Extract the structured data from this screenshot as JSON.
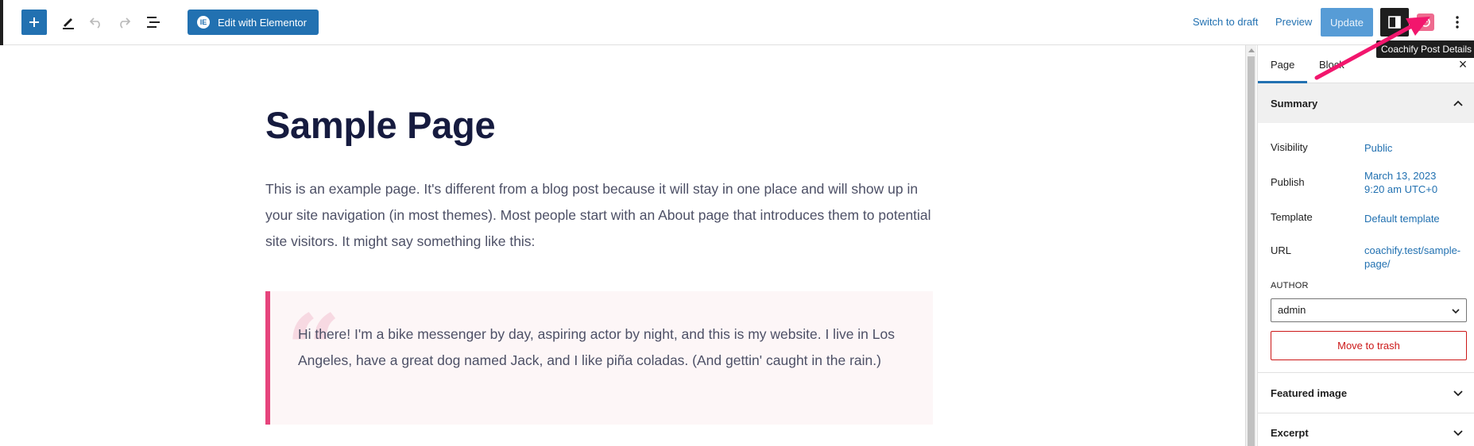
{
  "toolbar": {
    "edit_elementor_label": "Edit with Elementor",
    "elementor_badge": "IE",
    "switch_to_draft_label": "Switch to draft",
    "preview_label": "Preview",
    "update_label": "Update",
    "tooltip": "Coachify Post Details",
    "accent_color": "#2271b1"
  },
  "content": {
    "title": "Sample Page",
    "intro": "This is an example page. It's different from a blog post because it will stay in one place and will show up in your site navigation (in most themes). Most people start with an About page that introduces them to potential site visitors. It might say something like this:",
    "quote": "Hi there! I'm a bike messenger by day, aspiring actor by night, and this is my website. I live in Los Angeles, have a great dog named Jack, and I like piña coladas. (And gettin' caught in the rain.)",
    "quote_mark": "“"
  },
  "sidebar": {
    "tabs": [
      {
        "label": "Page",
        "active": true
      },
      {
        "label": "Block",
        "active": false
      }
    ],
    "close_icon": "×",
    "summary": {
      "heading": "Summary",
      "visibility_label": "Visibility",
      "visibility_value": "Public",
      "publish_label": "Publish",
      "publish_date": "March 13, 2023",
      "publish_time": "9:20 am UTC+0",
      "template_label": "Template",
      "template_value": "Default template",
      "url_label": "URL",
      "url_line1": "coachify.test/sample-",
      "url_line2": "page/",
      "author_label": "AUTHOR",
      "author_value": "admin",
      "trash_label": "Move to trash"
    },
    "featured_image_heading": "Featured image",
    "excerpt_heading": "Excerpt"
  }
}
